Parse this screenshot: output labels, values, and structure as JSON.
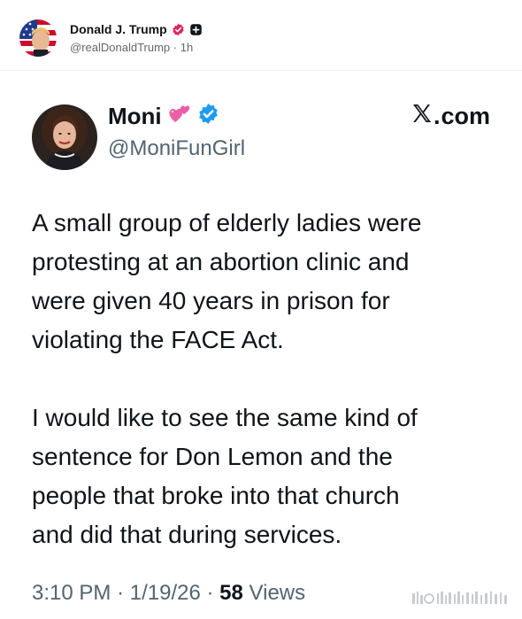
{
  "repost": {
    "author_name": "Donald J. Trump",
    "author_handle": "@realDonaldTrump",
    "separator": "·",
    "time_ago": "1h",
    "verified_badge": "verified-badge-icon",
    "plus_badge": "plus-square-icon"
  },
  "embedded_tweet": {
    "author_name": "Moni",
    "author_emoji": "💞",
    "author_handle": "@MoniFunGirl",
    "platform_label": "com",
    "platform_icon": "x-logo-icon",
    "paragraphs": [
      "A small group of elderly ladies were\nprotesting at an abortion clinic and\nwere given 40 years in prison for\nviolating the FACE Act.",
      "I would like to see the same kind of\nsentence for Don Lemon and the\npeople that broke into that church\nand did that during services."
    ],
    "time": "3:10 PM",
    "date": "1/19/26",
    "views_count": "58",
    "views_label": "Views",
    "meta_separator": "·"
  },
  "colors": {
    "text_primary": "#0f1419",
    "text_secondary": "#536471",
    "verified_blue": "#1d9bf0",
    "verified_pink": "#e0245e",
    "border": "#eef0f2"
  }
}
